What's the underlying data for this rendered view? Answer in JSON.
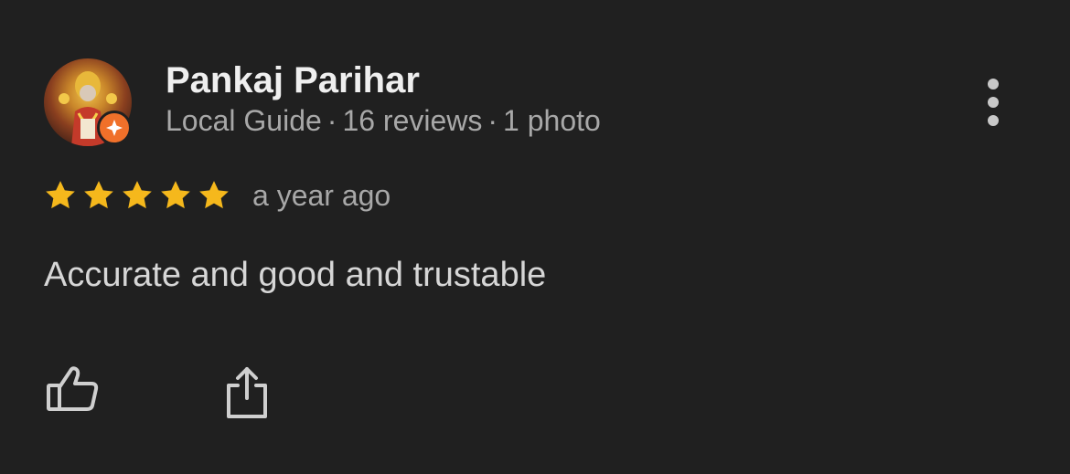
{
  "review": {
    "author_name": "Pankaj Parihar",
    "author_meta": {
      "role": "Local Guide",
      "separator": "·",
      "reviews": "16 reviews",
      "photos": "1 photo"
    },
    "rating": 5,
    "rating_max": 5,
    "time": "a year ago",
    "text": "Accurate and good and trustable"
  },
  "icons": {
    "guide_badge": "local-guide-badge-icon",
    "more": "more-vertical-icon",
    "star": "star-icon",
    "like": "thumbs-up-icon",
    "share": "share-icon"
  },
  "colors": {
    "background": "#202020",
    "star": "#f5b81c",
    "badge": "#f0702a",
    "name": "#efefef",
    "meta": "#a8a8a8"
  }
}
